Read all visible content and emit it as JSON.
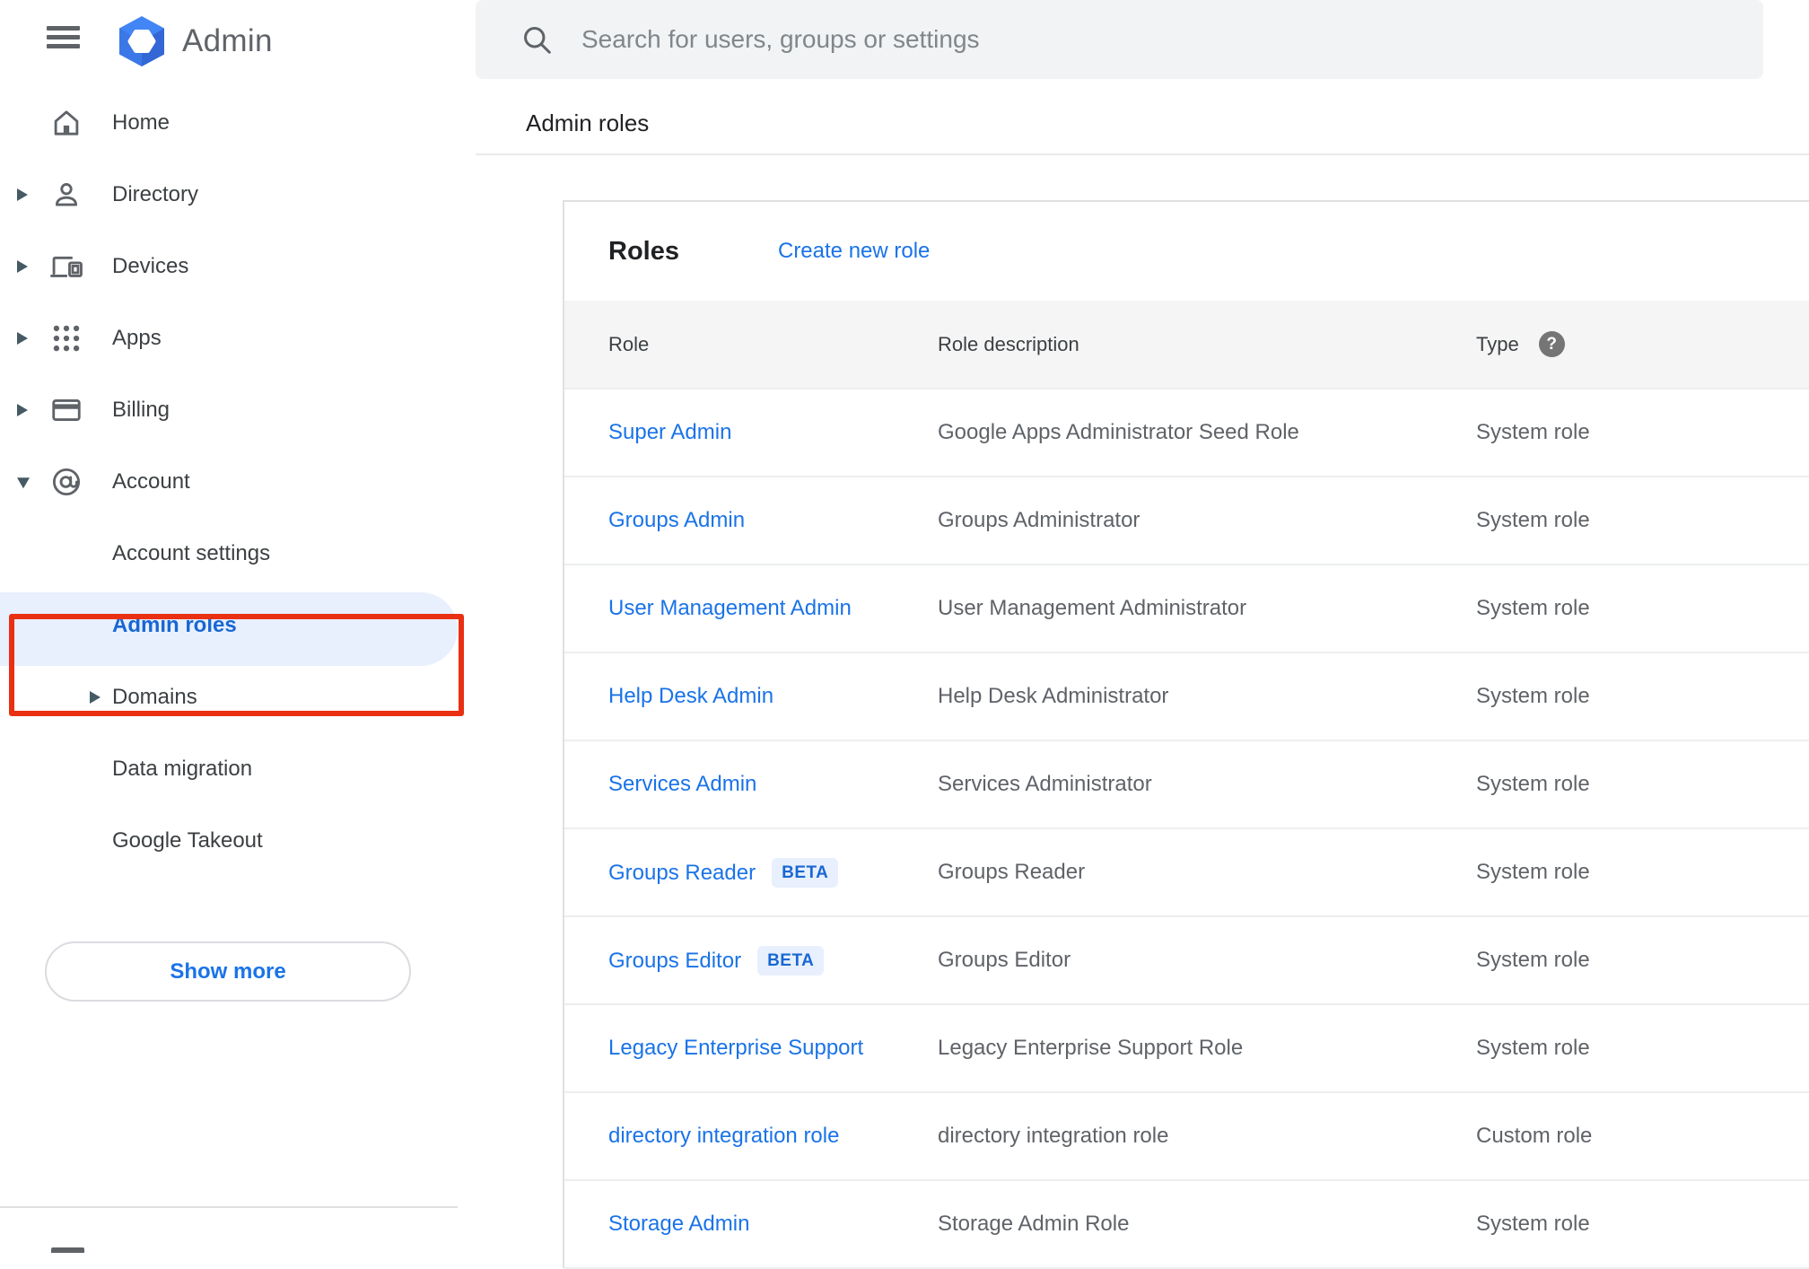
{
  "app": {
    "name": "Admin",
    "logo_icon": "admin-hexagon-logo",
    "menu_icon": "hamburger-menu-icon"
  },
  "search": {
    "placeholder": "Search for users, groups or settings",
    "icon": "search-icon"
  },
  "page": {
    "title": "Admin roles"
  },
  "sidebar": {
    "items": [
      {
        "label": "Home",
        "icon": "home",
        "arrow": null,
        "nested": false,
        "selected": false
      },
      {
        "label": "Directory",
        "icon": "person",
        "arrow": "right",
        "nested": false,
        "selected": false
      },
      {
        "label": "Devices",
        "icon": "devices",
        "arrow": "right",
        "nested": false,
        "selected": false
      },
      {
        "label": "Apps",
        "icon": "apps",
        "arrow": "right",
        "nested": false,
        "selected": false
      },
      {
        "label": "Billing",
        "icon": "billing",
        "arrow": "right",
        "nested": false,
        "selected": false
      },
      {
        "label": "Account",
        "icon": "at",
        "arrow": "down",
        "nested": false,
        "selected": false
      },
      {
        "label": "Account settings",
        "icon": null,
        "arrow": null,
        "nested": true,
        "selected": false
      },
      {
        "label": "Admin roles",
        "icon": null,
        "arrow": null,
        "nested": true,
        "selected": true
      },
      {
        "label": "Domains",
        "icon": null,
        "arrow": "right",
        "nested": true,
        "selected": false
      },
      {
        "label": "Data migration",
        "icon": null,
        "arrow": null,
        "nested": true,
        "selected": false
      },
      {
        "label": "Google Takeout",
        "icon": null,
        "arrow": null,
        "nested": true,
        "selected": false
      }
    ],
    "show_more_label": "Show more"
  },
  "annotation": {
    "shape": "red-highlight-box",
    "color": "#e93013",
    "highlights": "Admin roles"
  },
  "roles_card": {
    "title": "Roles",
    "create_link": "Create new role",
    "columns": [
      "Role",
      "Role description",
      "Type"
    ],
    "type_help_icon": "help-icon",
    "help_glyph": "?",
    "beta_label": "BETA",
    "rows": [
      {
        "role": "Super Admin",
        "beta": false,
        "description": "Google Apps Administrator Seed Role",
        "type": "System role"
      },
      {
        "role": "Groups Admin",
        "beta": false,
        "description": "Groups Administrator",
        "type": "System role"
      },
      {
        "role": "User Management Admin",
        "beta": false,
        "description": "User Management Administrator",
        "type": "System role"
      },
      {
        "role": "Help Desk Admin",
        "beta": false,
        "description": "Help Desk Administrator",
        "type": "System role"
      },
      {
        "role": "Services Admin",
        "beta": false,
        "description": "Services Administrator",
        "type": "System role"
      },
      {
        "role": "Groups Reader",
        "beta": true,
        "description": "Groups Reader",
        "type": "System role"
      },
      {
        "role": "Groups Editor",
        "beta": true,
        "description": "Groups Editor",
        "type": "System role"
      },
      {
        "role": "Legacy Enterprise Support",
        "beta": false,
        "description": "Legacy Enterprise Support Role",
        "type": "System role"
      },
      {
        "role": "directory integration role",
        "beta": false,
        "description": "directory integration role",
        "type": "Custom role"
      },
      {
        "role": "Storage Admin",
        "beta": false,
        "description": "Storage Admin Role",
        "type": "System role"
      }
    ]
  },
  "colors": {
    "link_blue": "#1a73e8",
    "selected_blue": "#1967d2",
    "beta_bg": "#e8f0fe",
    "pill_bg": "#e8f0fe",
    "annotation_red": "#e93013",
    "table_header_bg": "#f5f5f5",
    "icon_gray": "#5f6368"
  }
}
